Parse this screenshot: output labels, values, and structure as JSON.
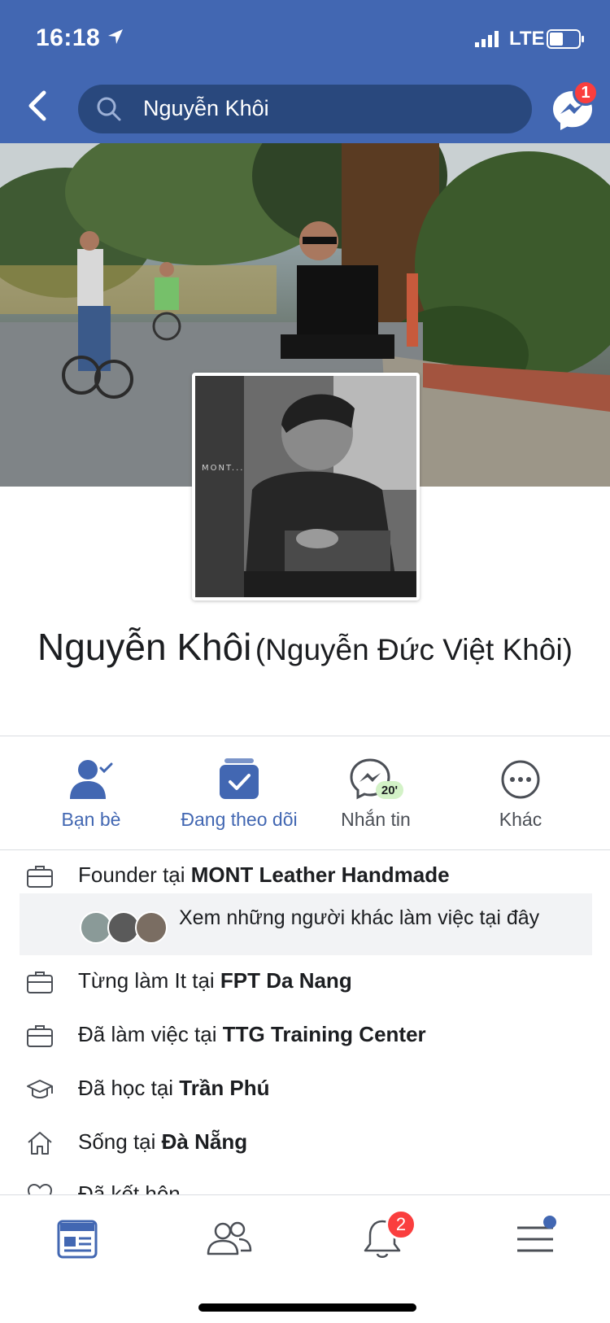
{
  "status_bar": {
    "time": "16:18",
    "network": "LTE"
  },
  "header": {
    "search_value": "Nguyễn Khôi",
    "messenger_badge": "1"
  },
  "profile": {
    "name": "Nguyễn Khôi",
    "alternate_name": "(Nguyễn Đức Việt Khôi)",
    "photo_watermark": "MONT..."
  },
  "actions": [
    {
      "label": "Bạn bè",
      "icon": "friends-check-icon"
    },
    {
      "label": "Đang theo dõi",
      "icon": "following-check-icon"
    },
    {
      "label": "Nhắn tin",
      "icon": "messenger-icon",
      "badge": "20'"
    },
    {
      "label": "Khác",
      "icon": "more-icon"
    }
  ],
  "about": {
    "work": {
      "prefix": "Founder tại ",
      "place": "MONT Leather Handmade"
    },
    "coworkers_text": "Xem những người khác làm việc tại đây",
    "previous_work_1": {
      "prefix": "Từng làm It tại ",
      "place": "FPT Da Nang"
    },
    "previous_work_2": {
      "prefix": "Đã làm việc tại ",
      "place": "TTG Training Center"
    },
    "education": {
      "prefix": "Đã học tại ",
      "place": "Trần Phú"
    },
    "lives": {
      "prefix": "Sống tại ",
      "place": "Đà Nẵng"
    },
    "relationship": {
      "prefix": "Đã kết hôn"
    }
  },
  "bottom_nav": {
    "notifications_badge": "2"
  },
  "colors": {
    "brand_blue": "#4267b2",
    "search_bg": "#29487d",
    "badge_red": "#fa3e3e"
  }
}
